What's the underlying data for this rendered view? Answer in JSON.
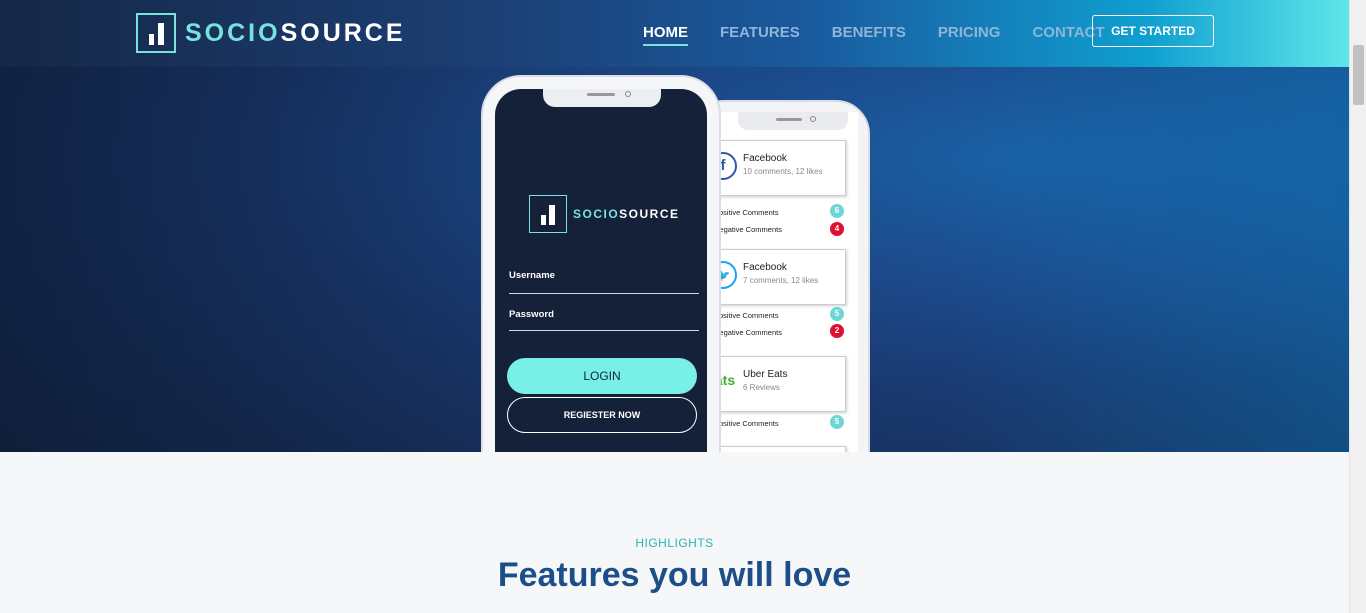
{
  "brand": {
    "name_part1": "SOCIO",
    "name_part2": "SOURCE"
  },
  "nav": {
    "items": [
      {
        "label": "HOME",
        "active": true
      },
      {
        "label": "FEATURES",
        "active": false
      },
      {
        "label": "BENEFITS",
        "active": false
      },
      {
        "label": "PRICING",
        "active": false
      },
      {
        "label": "CONTACT",
        "active": false
      }
    ],
    "cta_label": "GET STARTED"
  },
  "login_screen": {
    "username_label": "Username",
    "password_label": "Password",
    "login_button": "LOGIN",
    "register_button": "REGIESTER NOW"
  },
  "feed_screen": {
    "cards": [
      {
        "icon": "facebook-icon",
        "title": "Facebook",
        "subtitle": "10 comments, 12 likes",
        "positive_label": "Positive Comments",
        "positive_count": "6",
        "negative_label": "Negative Comments",
        "negative_count": "4"
      },
      {
        "icon": "twitter-icon",
        "title": "Facebook",
        "subtitle": "7 comments, 12 likes",
        "positive_label": "Positive Comments",
        "positive_count": "5",
        "negative_label": "Negative Comments",
        "negative_count": "2"
      },
      {
        "icon": "uber-eats-icon",
        "title": "Uber Eats",
        "subtitle": "6 Reviews",
        "positive_label": "Positive Comments",
        "positive_count": "5"
      }
    ]
  },
  "highlights": {
    "eyebrow": "HIGHLIGHTS",
    "heading": "Features you will love"
  },
  "colors": {
    "accent": "#78e3de",
    "heading": "#1c4f8a",
    "negative": "#e0102e"
  }
}
